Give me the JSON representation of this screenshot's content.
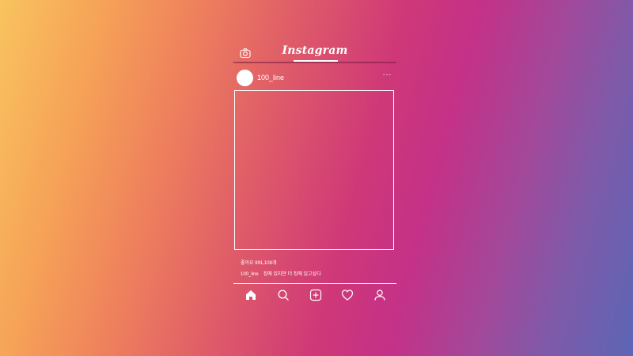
{
  "app": {
    "logo_text": "Instagram"
  },
  "post": {
    "username": "100_line",
    "more_label": "···",
    "likes_text": "좋아요 991,108개",
    "caption_user": "100_line",
    "caption_text": "집에 있지만 더 집에 있고싶다"
  },
  "icons": {
    "camera": "camera-icon",
    "more": "more-icon",
    "home": "home-icon",
    "search": "search-icon",
    "add": "add-post-icon",
    "heart": "heart-icon",
    "profile": "profile-icon"
  },
  "colors": {
    "foreground": "#ffffff",
    "gradient": [
      "#f9c35f",
      "#ee7f5d",
      "#cf3878",
      "#a3489a",
      "#5b66b5"
    ]
  }
}
